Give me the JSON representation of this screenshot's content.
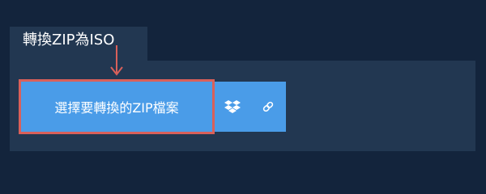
{
  "tab": {
    "title": "轉換ZIP為ISO"
  },
  "upload": {
    "choose_label": "選擇要轉換的ZIP檔案",
    "dropbox_icon": "dropbox-icon",
    "link_icon": "link-icon"
  },
  "colors": {
    "background": "#13243c",
    "panel": "#223751",
    "button": "#4a9ce8",
    "highlight": "#d9605a",
    "text": "#ffffff"
  }
}
